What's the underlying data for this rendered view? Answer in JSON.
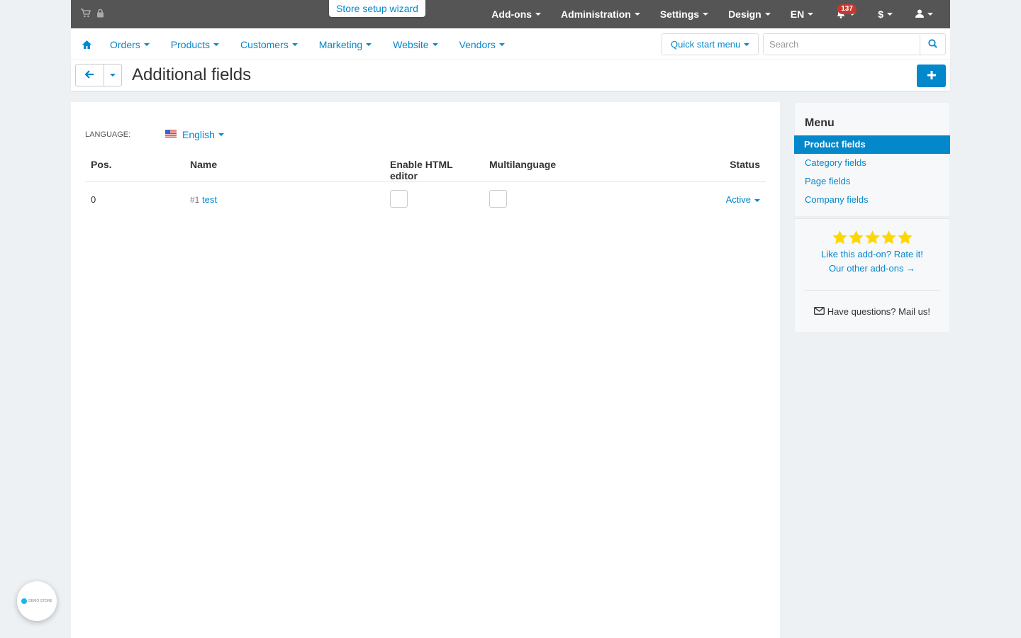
{
  "topbar": {
    "wizard_label": "Store setup wizard",
    "nav": [
      {
        "label": "Add-ons"
      },
      {
        "label": "Administration"
      },
      {
        "label": "Settings"
      },
      {
        "label": "Design"
      },
      {
        "label": "EN"
      }
    ],
    "notifications_count": "137",
    "currency_label": "$"
  },
  "subnav": {
    "items": [
      "Orders",
      "Products",
      "Customers",
      "Marketing",
      "Website",
      "Vendors"
    ],
    "quick_start_label": "Quick start menu",
    "search_placeholder": "Search"
  },
  "page": {
    "title": "Additional fields"
  },
  "main": {
    "language_label": "LANGUAGE:",
    "language_value": "English",
    "table": {
      "columns": [
        "Pos.",
        "Name",
        "Enable HTML editor",
        "Multilanguage",
        "Status"
      ],
      "rows": [
        {
          "pos": "0",
          "id": "#1",
          "name": "test",
          "status": "Active"
        }
      ]
    }
  },
  "sidebar": {
    "title": "Menu",
    "items": [
      {
        "label": "Product fields",
        "active": true
      },
      {
        "label": "Category fields"
      },
      {
        "label": "Page fields"
      },
      {
        "label": "Company fields"
      }
    ],
    "rate_label": "Like this add-on? Rate it!",
    "other_label": "Our other add-ons →",
    "mail_label": "Have questions? Mail us!"
  },
  "colors": {
    "accent": "#0388cc",
    "topbar": "#555555",
    "badge": "#c7382f",
    "star": "#ffd700"
  }
}
